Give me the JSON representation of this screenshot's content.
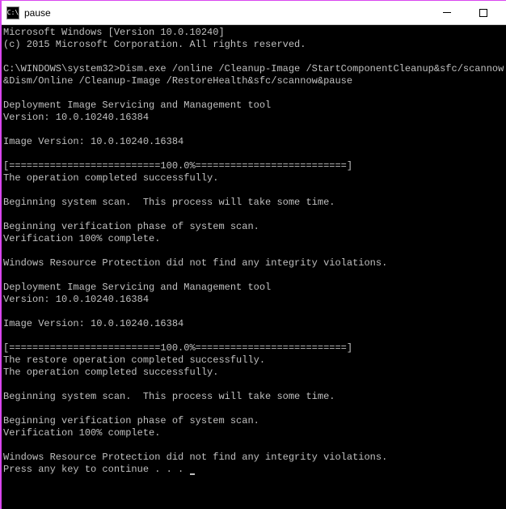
{
  "titlebar": {
    "icon_text": "C:\\",
    "title": "pause"
  },
  "terminal": {
    "lines": [
      "Microsoft Windows [Version 10.0.10240]",
      "(c) 2015 Microsoft Corporation. All rights reserved.",
      "",
      "C:\\WINDOWS\\system32>Dism.exe /online /Cleanup-Image /StartComponentCleanup&sfc/scannow&Dism/Online /Cleanup-Image /RestoreHealth&sfc/scannow&pause",
      "",
      "Deployment Image Servicing and Management tool",
      "Version: 10.0.10240.16384",
      "",
      "Image Version: 10.0.10240.16384",
      "",
      "[==========================100.0%==========================]",
      "The operation completed successfully.",
      "",
      "Beginning system scan.  This process will take some time.",
      "",
      "Beginning verification phase of system scan.",
      "Verification 100% complete.",
      "",
      "Windows Resource Protection did not find any integrity violations.",
      "",
      "Deployment Image Servicing and Management tool",
      "Version: 10.0.10240.16384",
      "",
      "Image Version: 10.0.10240.16384",
      "",
      "[==========================100.0%==========================]",
      "The restore operation completed successfully.",
      "The operation completed successfully.",
      "",
      "Beginning system scan.  This process will take some time.",
      "",
      "Beginning verification phase of system scan.",
      "Verification 100% complete.",
      "",
      "Windows Resource Protection did not find any integrity violations.",
      "Press any key to continue . . . "
    ]
  }
}
